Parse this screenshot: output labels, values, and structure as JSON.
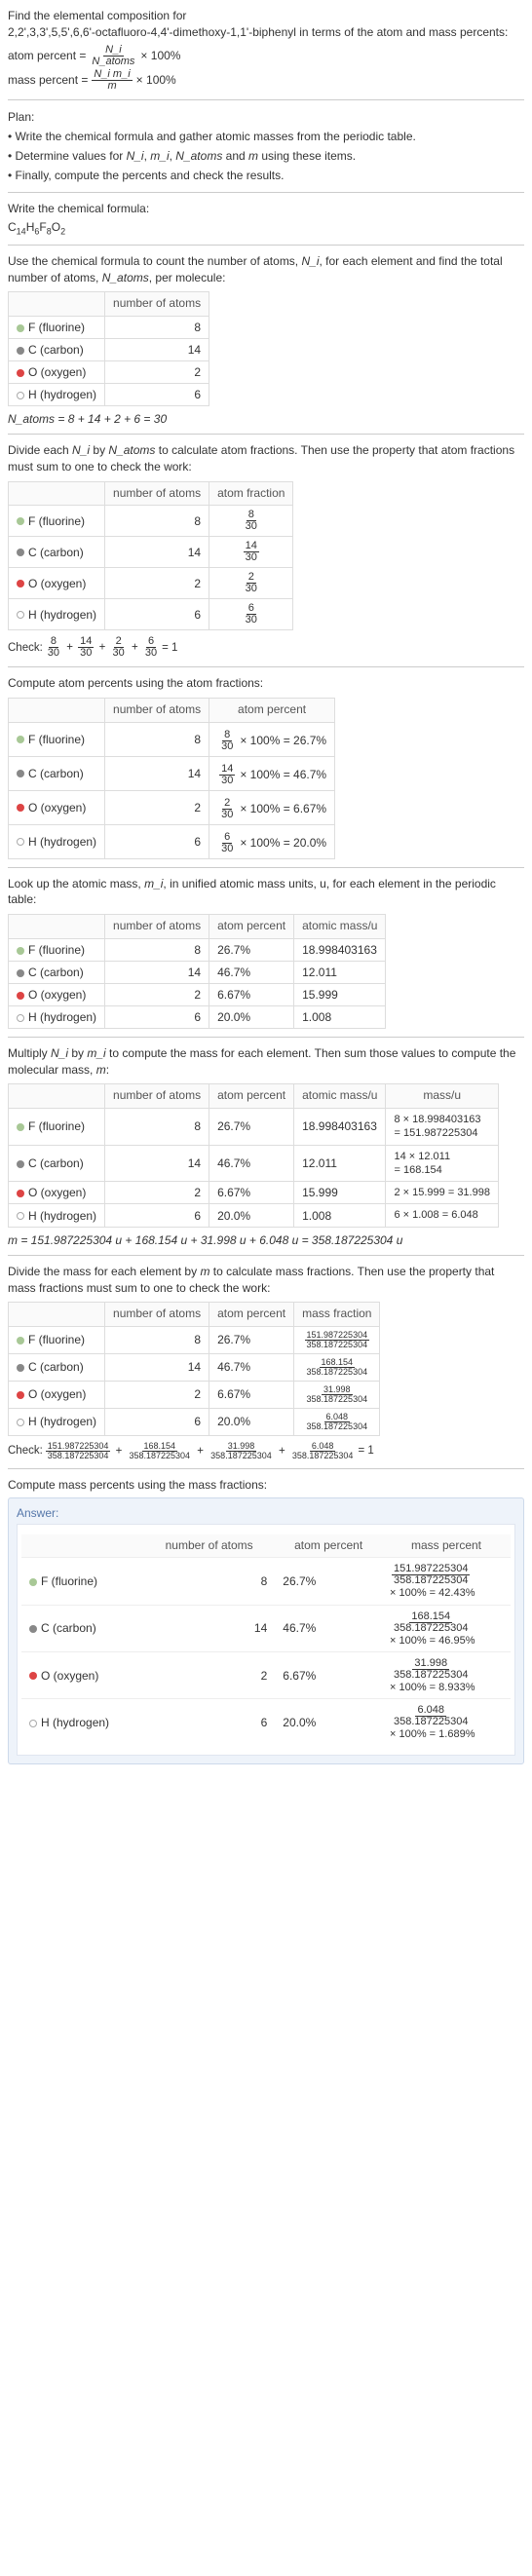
{
  "intro": {
    "l1": "Find the elemental composition for",
    "l2": "2,2',3,3',5,5',6,6'-octafluoro-4,4'-dimethoxy-1,1'-biphenyl in terms of the atom and mass percents:",
    "ap_label": "atom percent =",
    "ap_num": "N_i",
    "ap_den": "N_atoms",
    "times100": "× 100%",
    "mp_label": "mass percent =",
    "mp_num": "N_i m_i",
    "mp_den": "m"
  },
  "plan": {
    "title": "Plan:",
    "i1": "• Write the chemical formula and gather atomic masses from the periodic table.",
    "i2_a": "• Determine values for ",
    "i2_b": " and ",
    "i2_c": " using these items.",
    "ni": "N_i",
    "mi": "m_i",
    "natoms": "N_atoms",
    "m": "m",
    "i3": "• Finally, compute the percents and check the results."
  },
  "s_formula": {
    "text": "Write the chemical formula:",
    "formula_parts": {
      "c": "C",
      "c_n": "14",
      "h": "H",
      "h_n": "6",
      "f": "F",
      "f_n": "8",
      "o": "O",
      "o_n": "2"
    }
  },
  "s_count": {
    "text_a": "Use the chemical formula to count the number of atoms, ",
    "ni": "N_i",
    "text_b": ", for each element and find the total number of atoms, ",
    "natoms": "N_atoms",
    "text_c": ", per molecule:",
    "h_num": "number of atoms",
    "rows": [
      {
        "el": "F (fluorine)",
        "n": "8",
        "dot": "dot-f"
      },
      {
        "el": "C (carbon)",
        "n": "14",
        "dot": "dot-c"
      },
      {
        "el": "O (oxygen)",
        "n": "2",
        "dot": "dot-o"
      },
      {
        "el": "H (hydrogen)",
        "n": "6",
        "dot": "dot-h"
      }
    ],
    "total": "N_atoms = 8 + 14 + 2 + 6 = 30"
  },
  "s_atomfrac": {
    "text_a": "Divide each ",
    "text_b": " by ",
    "text_c": " to calculate atom fractions. Then use the property that atom fractions must sum to one to check the work:",
    "h_num": "number of atoms",
    "h_frac": "atom fraction",
    "rows": [
      {
        "el": "F (fluorine)",
        "n": "8",
        "fn": "8",
        "fd": "30",
        "dot": "dot-f"
      },
      {
        "el": "C (carbon)",
        "n": "14",
        "fn": "14",
        "fd": "30",
        "dot": "dot-c"
      },
      {
        "el": "O (oxygen)",
        "n": "2",
        "fn": "2",
        "fd": "30",
        "dot": "dot-o"
      },
      {
        "el": "H (hydrogen)",
        "n": "6",
        "fn": "6",
        "fd": "30",
        "dot": "dot-h"
      }
    ],
    "check_label": "Check:",
    "check_eq": "= 1"
  },
  "s_atompct": {
    "text": "Compute atom percents using the atom fractions:",
    "h_num": "number of atoms",
    "h_pct": "atom percent",
    "rows": [
      {
        "el": "F (fluorine)",
        "n": "8",
        "fn": "8",
        "fd": "30",
        "pct": "= 26.7%",
        "dot": "dot-f"
      },
      {
        "el": "C (carbon)",
        "n": "14",
        "fn": "14",
        "fd": "30",
        "pct": "= 46.7%",
        "dot": "dot-c"
      },
      {
        "el": "O (oxygen)",
        "n": "2",
        "fn": "2",
        "fd": "30",
        "pct": "= 6.67%",
        "dot": "dot-o"
      },
      {
        "el": "H (hydrogen)",
        "n": "6",
        "fn": "6",
        "fd": "30",
        "pct": "= 20.0%",
        "dot": "dot-h"
      }
    ]
  },
  "s_mass": {
    "text_a": "Look up the atomic mass, ",
    "mi": "m_i",
    "text_b": ", in unified atomic mass units, u, for each element in the periodic table:",
    "h_num": "number of atoms",
    "h_pct": "atom percent",
    "h_mass": "atomic mass/u",
    "rows": [
      {
        "el": "F (fluorine)",
        "n": "8",
        "pct": "26.7%",
        "mass": "18.998403163",
        "dot": "dot-f"
      },
      {
        "el": "C (carbon)",
        "n": "14",
        "pct": "46.7%",
        "mass": "12.011",
        "dot": "dot-c"
      },
      {
        "el": "O (oxygen)",
        "n": "2",
        "pct": "6.67%",
        "mass": "15.999",
        "dot": "dot-o"
      },
      {
        "el": "H (hydrogen)",
        "n": "6",
        "pct": "20.0%",
        "mass": "1.008",
        "dot": "dot-h"
      }
    ]
  },
  "s_molmass": {
    "text_a": "Multiply ",
    "text_b": " by ",
    "text_c": " to compute the mass for each element. Then sum those values to compute the molecular mass, ",
    "text_d": ":",
    "ni": "N_i",
    "mi": "m_i",
    "m": "m",
    "h_num": "number of atoms",
    "h_pct": "atom percent",
    "h_amass": "atomic mass/u",
    "h_mass": "mass/u",
    "rows": [
      {
        "el": "F (fluorine)",
        "n": "8",
        "pct": "26.7%",
        "amass": "18.998403163",
        "mass_a": "8 × 18.998403163",
        "mass_b": "= 151.987225304",
        "dot": "dot-f"
      },
      {
        "el": "C (carbon)",
        "n": "14",
        "pct": "46.7%",
        "amass": "12.011",
        "mass_a": "14 × 12.011",
        "mass_b": "= 168.154",
        "dot": "dot-c"
      },
      {
        "el": "O (oxygen)",
        "n": "2",
        "pct": "6.67%",
        "amass": "15.999",
        "mass_a": "2 × 15.999 = 31.998",
        "mass_b": "",
        "dot": "dot-o"
      },
      {
        "el": "H (hydrogen)",
        "n": "6",
        "pct": "20.0%",
        "amass": "1.008",
        "mass_a": "6 × 1.008 = 6.048",
        "mass_b": "",
        "dot": "dot-h"
      }
    ],
    "total": "m = 151.987225304 u + 168.154 u + 31.998 u + 6.048 u = 358.187225304 u"
  },
  "s_massfrac": {
    "text_a": "Divide the mass for each element by ",
    "m": "m",
    "text_b": " to calculate mass fractions. Then use the property that mass fractions must sum to one to check the work:",
    "h_num": "number of atoms",
    "h_pct": "atom percent",
    "h_frac": "mass fraction",
    "rows": [
      {
        "el": "F (fluorine)",
        "n": "8",
        "pct": "26.7%",
        "fn": "151.987225304",
        "fd": "358.187225304",
        "dot": "dot-f"
      },
      {
        "el": "C (carbon)",
        "n": "14",
        "pct": "46.7%",
        "fn": "168.154",
        "fd": "358.187225304",
        "dot": "dot-c"
      },
      {
        "el": "O (oxygen)",
        "n": "2",
        "pct": "6.67%",
        "fn": "31.998",
        "fd": "358.187225304",
        "dot": "dot-o"
      },
      {
        "el": "H (hydrogen)",
        "n": "6",
        "pct": "20.0%",
        "fn": "6.048",
        "fd": "358.187225304",
        "dot": "dot-h"
      }
    ],
    "check_label": "Check:",
    "check_eq": "= 1"
  },
  "s_final": {
    "text": "Compute mass percents using the mass fractions:",
    "answer_label": "Answer:",
    "h_num": "number of atoms",
    "h_apct": "atom percent",
    "h_mpct": "mass percent",
    "rows": [
      {
        "el": "F (fluorine)",
        "n": "8",
        "apct": "26.7%",
        "mn": "151.987225304",
        "md": "358.187225304",
        "res": "× 100% = 42.43%",
        "dot": "dot-f"
      },
      {
        "el": "C (carbon)",
        "n": "14",
        "apct": "46.7%",
        "mn": "168.154",
        "md": "358.187225304",
        "res": "× 100% = 46.95%",
        "dot": "dot-c"
      },
      {
        "el": "O (oxygen)",
        "n": "2",
        "apct": "6.67%",
        "mn": "31.998",
        "md": "358.187225304",
        "res": "× 100% = 8.933%",
        "dot": "dot-o"
      },
      {
        "el": "H (hydrogen)",
        "n": "6",
        "apct": "20.0%",
        "mn": "6.048",
        "md": "358.187225304",
        "res": "× 100% = 1.689%",
        "dot": "dot-h"
      }
    ]
  }
}
